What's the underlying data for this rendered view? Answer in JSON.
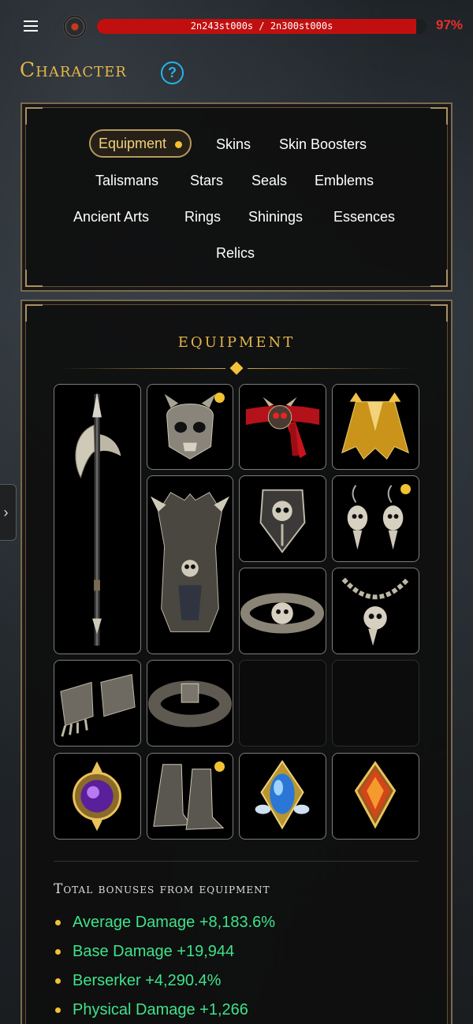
{
  "topbar": {
    "progress_text": "2n243st000s / 2n300st000s",
    "progress_fraction": 0.97,
    "percent_label": "97%",
    "icons": [
      "hamburger-menu-icon",
      "player-avatar-icon"
    ]
  },
  "header": {
    "title": "Character",
    "help_symbol": "?"
  },
  "tabs": [
    {
      "label": "Equipment",
      "active": true,
      "has_dot": true
    },
    {
      "label": "Skins"
    },
    {
      "label": "Skin Boosters"
    },
    {
      "label": "Talismans"
    },
    {
      "label": "Stars"
    },
    {
      "label": "Seals"
    },
    {
      "label": "Emblems"
    },
    {
      "label": "Ancient Arts"
    },
    {
      "label": "Rings"
    },
    {
      "label": "Shinings"
    },
    {
      "label": "Essences"
    },
    {
      "label": "Relics"
    }
  ],
  "equipment": {
    "section_title": "EQUIPMENT",
    "slots": [
      {
        "item": "halberd-weapon",
        "has_dot": false
      },
      {
        "item": "skull-helmet",
        "has_dot": true
      },
      {
        "item": "red-skull-belt",
        "has_dot": false
      },
      {
        "item": "golden-cape",
        "has_dot": false
      },
      {
        "item": "skull-armor",
        "has_dot": false
      },
      {
        "item": "skull-shield",
        "has_dot": false
      },
      {
        "item": "skull-earrings",
        "has_dot": true
      },
      {
        "item": "skull-bracelet",
        "has_dot": false
      },
      {
        "item": "skull-necklace",
        "has_dot": false
      },
      {
        "item": "iron-gauntlets",
        "has_dot": false
      },
      {
        "item": "iron-belt",
        "has_dot": false
      },
      {
        "item": "empty",
        "has_dot": false
      },
      {
        "item": "empty",
        "has_dot": false
      },
      {
        "item": "purple-gem-amulet",
        "has_dot": false
      },
      {
        "item": "skull-boots",
        "has_dot": true
      },
      {
        "item": "blue-gem-amulet",
        "has_dot": false
      },
      {
        "item": "fire-gem-amulet",
        "has_dot": false
      }
    ]
  },
  "bonuses": {
    "title": "Total bonuses from equipment",
    "items": [
      "Average Damage +8,183.6%",
      "Base Damage +19,944",
      "Berserker +4,290.4%",
      "Physical Damage +1,266"
    ]
  },
  "colors": {
    "gold": "#e4b648",
    "bonus_green": "#3ee38a",
    "progress_red": "#c10f0f",
    "help_blue": "#23b4ea",
    "notify_dot": "#f1c232"
  },
  "side_tab_icon": "chevron-right-icon"
}
